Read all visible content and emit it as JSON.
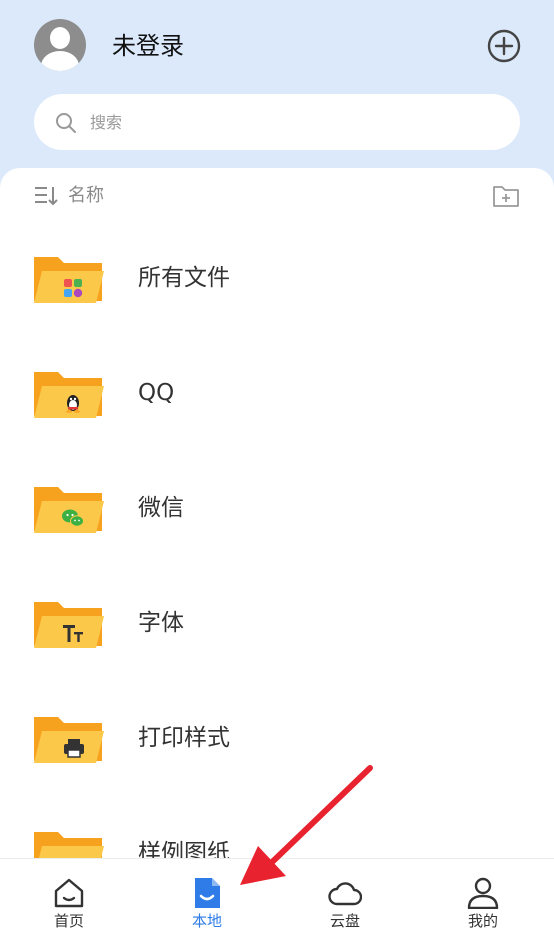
{
  "header": {
    "username": "未登录",
    "search_placeholder": "搜索",
    "icons": {
      "avatar": "user-avatar",
      "add": "plus-circle-icon",
      "search": "search-icon"
    }
  },
  "toolbar": {
    "sort_label": "名称",
    "icons": {
      "sort": "sort-icon",
      "new_folder": "new-folder-icon"
    }
  },
  "folders": [
    {
      "label": "所有文件",
      "badge": "apps-grid"
    },
    {
      "label": "QQ",
      "badge": "qq-penguin"
    },
    {
      "label": "微信",
      "badge": "wechat"
    },
    {
      "label": "字体",
      "badge": "font-tt",
      "badge_text": "TT"
    },
    {
      "label": "打印样式",
      "badge": "printer"
    },
    {
      "label": "样例图纸",
      "badge": "none"
    }
  ],
  "bottom_nav": [
    {
      "label": "首页",
      "icon": "home-icon",
      "active": false
    },
    {
      "label": "本地",
      "icon": "local-file-icon",
      "active": true
    },
    {
      "label": "云盘",
      "icon": "cloud-icon",
      "active": false
    },
    {
      "label": "我的",
      "icon": "profile-icon",
      "active": false
    }
  ],
  "colors": {
    "header_bg": "#dbe9fb",
    "accent": "#2f7be7",
    "folder_back": "#f7a21e",
    "folder_front": "#fbc84a",
    "annotation_arrow": "#e8222e"
  }
}
